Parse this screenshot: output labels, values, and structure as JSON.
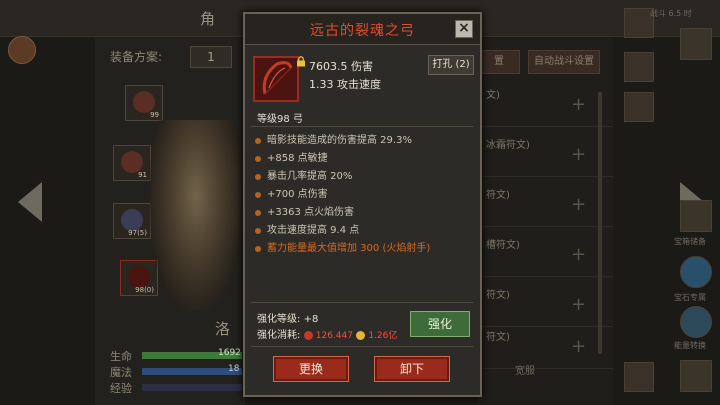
{
  "background": {
    "title_partial": "角",
    "equip_scheme_label": "装备方案:",
    "equip_scheme_value": "1",
    "slots": [
      {
        "num": "99"
      },
      {
        "num": "91"
      },
      {
        "num": "97(5)"
      },
      {
        "num": "98(0)"
      }
    ],
    "hero_name_partial": "洛",
    "stats": [
      {
        "label": "生命",
        "value": "1692"
      },
      {
        "label": "魔法",
        "value": "18"
      },
      {
        "label": "经验",
        "value": ""
      }
    ],
    "right_buttons": [
      "置",
      "自动战斗设置"
    ],
    "rune_rows": [
      "文)",
      "冰霜符文)",
      "符文)",
      "槽符文)",
      "符文)",
      "符文)"
    ],
    "bottom_right_partial": "宽服",
    "side_labels": [
      "宝箱储备",
      "宝石专属",
      "能量转换"
    ],
    "top_right_partial": "战斗 6.5 时"
  },
  "dialog": {
    "title": "远古的裂魂之弓",
    "damage": "7603.5 伤害",
    "attack_speed": "1.33 攻击速度",
    "socket_button": "打孔 (2)",
    "level": "等级98 弓",
    "attributes": [
      "暗影技能造成的伤害提高 29.3%",
      "+858 点敏捷",
      "暴击几率提高 20%",
      "+700 点伤害",
      "+3363 点火焰伤害",
      "攻击速度提高 9.4 点",
      "蓄力能量最大值增加 300 (火焰射手)"
    ],
    "enhance_level_label": "强化等级:",
    "enhance_level_value": "+8",
    "enhance_cost_label": "强化消耗:",
    "enhance_cost_1": "126.447",
    "enhance_cost_2": "1.26亿",
    "enhance_button": "强化",
    "replace_button": "更换",
    "unequip_button": "卸下"
  },
  "colors": {
    "title_red": "#e84a2e",
    "special_attr": "#d96a1e",
    "enhance_green": "#3e6b3a",
    "action_red": "#9a2b1c"
  }
}
